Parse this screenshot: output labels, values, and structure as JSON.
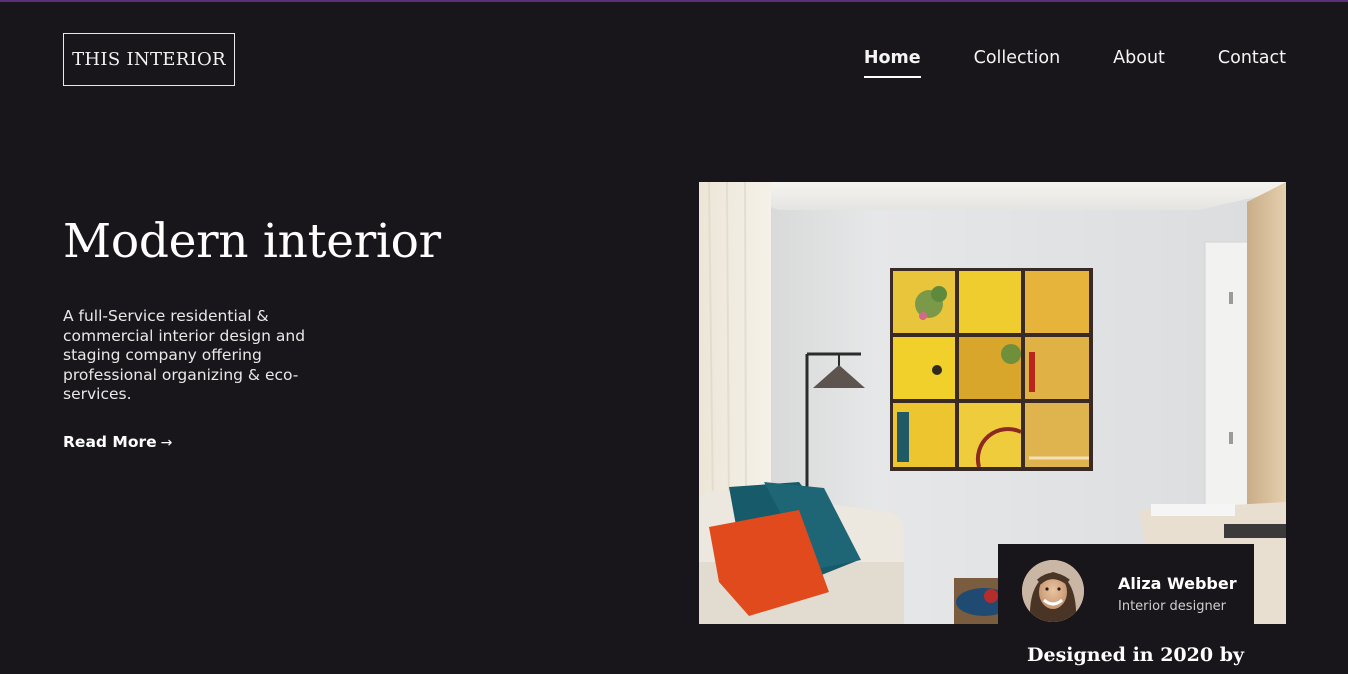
{
  "brand": {
    "logo_text": "THIS INTERIOR"
  },
  "nav": {
    "items": [
      {
        "label": "Home",
        "active": true
      },
      {
        "label": "Collection",
        "active": false
      },
      {
        "label": "About",
        "active": false
      },
      {
        "label": "Contact",
        "active": false
      }
    ]
  },
  "hero": {
    "title": "Modern interior",
    "description": "A full-Service residential & commercial interior design and staging company offering professional organizing & eco-services.",
    "cta_label": "Read More",
    "cta_arrow": "→"
  },
  "designer_card": {
    "name": "Aliza Webber",
    "role": "Interior designer",
    "caption": "Designed in 2020 by"
  },
  "colors": {
    "background": "#18161a",
    "accent_topline": "#5b2d7a",
    "text": "#ffffff"
  }
}
